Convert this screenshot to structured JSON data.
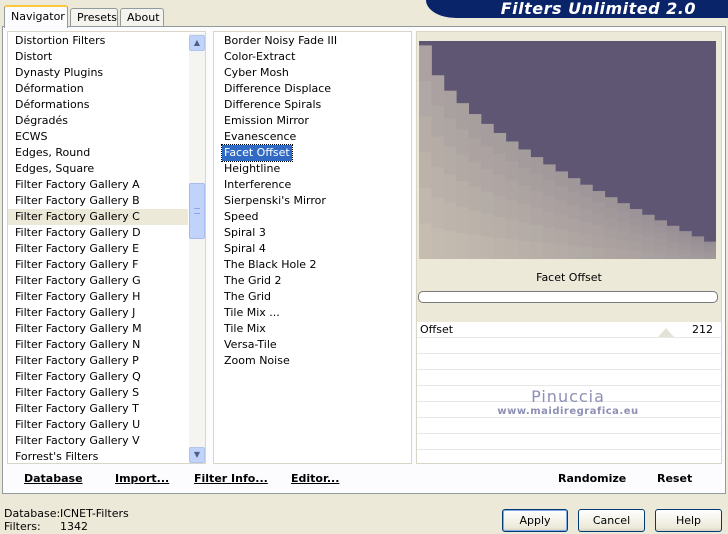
{
  "tabs": [
    {
      "label": "Navigator",
      "active": true
    },
    {
      "label": "Presets",
      "active": false
    },
    {
      "label": "About",
      "active": false
    }
  ],
  "banner_title": "Filters Unlimited 2.0",
  "categories": {
    "items": [
      "Distortion Filters",
      "Distort",
      "Dynasty Plugins",
      "Déformation",
      "Déformations",
      "Dégradés",
      "ECWS",
      "Edges, Round",
      "Edges, Square",
      "Filter Factory Gallery A",
      "Filter Factory Gallery B",
      "Filter Factory Gallery C",
      "Filter Factory Gallery D",
      "Filter Factory Gallery E",
      "Filter Factory Gallery F",
      "Filter Factory Gallery G",
      "Filter Factory Gallery H",
      "Filter Factory Gallery J",
      "Filter Factory Gallery M",
      "Filter Factory Gallery N",
      "Filter Factory Gallery P",
      "Filter Factory Gallery Q",
      "Filter Factory Gallery S",
      "Filter Factory Gallery T",
      "Filter Factory Gallery U",
      "Filter Factory Gallery V",
      "Forrest's Filters"
    ],
    "selected": "Filter Factory Gallery C"
  },
  "filters": {
    "items": [
      "Border Noisy Fade III",
      "Color-Extract",
      "Cyber Mosh",
      "Difference Displace",
      "Difference Spirals",
      "Emission Mirror",
      "Evanescence",
      "Facet Offset",
      "Heightline",
      "Interference",
      "Sierpenski's Mirror",
      "Speed",
      "Spiral 3",
      "Spiral 4",
      "The Black Hole 2",
      "The Grid 2",
      "The Grid",
      "Tile Mix ...",
      "Tile Mix",
      "Versa-Tile",
      "Zoom Noise"
    ],
    "selected": "Facet Offset"
  },
  "preview": {
    "filter_name": "Facet Offset",
    "colors": {
      "dark": "#5e5672",
      "light": "#cbc2b4"
    }
  },
  "parameters": [
    {
      "name": "Offset",
      "value": "212"
    }
  ],
  "watermark": {
    "name": "Pinuccia",
    "url": "www.maidiregrafica.eu"
  },
  "toolbar": {
    "database": "Database",
    "import": "Import...",
    "filter_info": "Filter Info...",
    "editor": "Editor...",
    "randomize": "Randomize",
    "reset": "Reset"
  },
  "status": {
    "database_label": "Database:",
    "database_value": "ICNET-Filters",
    "filters_label": "Filters:",
    "filters_value": "1342"
  },
  "dialog": {
    "apply": "Apply",
    "cancel": "Cancel",
    "help": "Help"
  },
  "colors": {
    "selection": "#316ac5",
    "banner": "#0a246a",
    "window": "#ece9d8"
  }
}
